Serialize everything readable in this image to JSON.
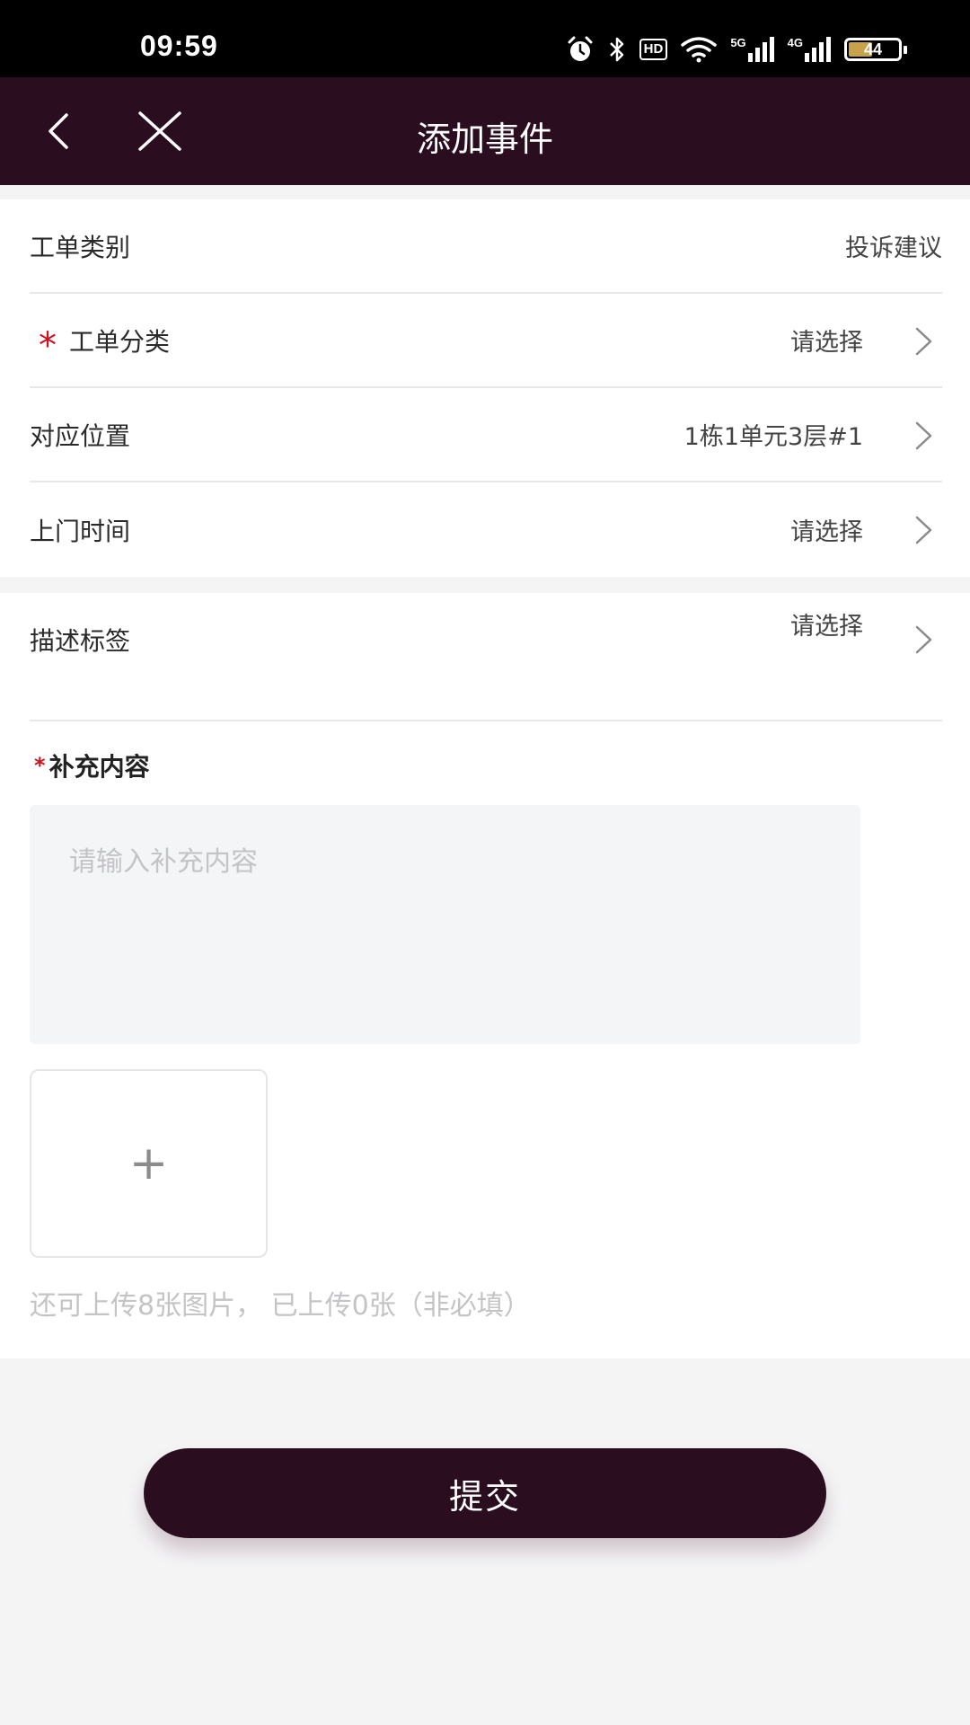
{
  "status_bar": {
    "time": "09:59",
    "hd_label": "HD",
    "net_5g": "5G",
    "net_4g": "4G",
    "battery_level": "44",
    "icons": [
      "alarm-icon",
      "bluetooth-icon",
      "hd-icon",
      "wifi-icon",
      "signal-5g-icon",
      "signal-4g-icon",
      "battery-icon"
    ]
  },
  "nav": {
    "title": "添加事件",
    "back_icon": "chevron-left-icon",
    "close_icon": "close-icon",
    "background": "#2a0e1f"
  },
  "form": {
    "rows": [
      {
        "label": "工单类别",
        "value": "投诉建议",
        "required": false,
        "chevron": false
      },
      {
        "label": "工单分类",
        "value": "请选择",
        "required": true,
        "chevron": true
      },
      {
        "label": "对应位置",
        "value": "1栋1单元3层#1",
        "required": false,
        "chevron": true
      },
      {
        "label": "上门时间",
        "value": "请选择",
        "required": false,
        "chevron": true
      },
      {
        "label": "描述标签",
        "value": "请选择",
        "required": false,
        "chevron": true
      }
    ],
    "required_mark": "*",
    "supplement": {
      "label": "补充内容",
      "required": true,
      "placeholder": "请输入补充内容",
      "value": ""
    },
    "upload": {
      "plus": "+",
      "hint": "还可上传8张图片， 已上传0张（非必填）"
    }
  },
  "submit_label": "提交",
  "colors": {
    "accent": "#2a0e1f",
    "required": "#d0101c",
    "page_bg": "#f4f4f5"
  }
}
